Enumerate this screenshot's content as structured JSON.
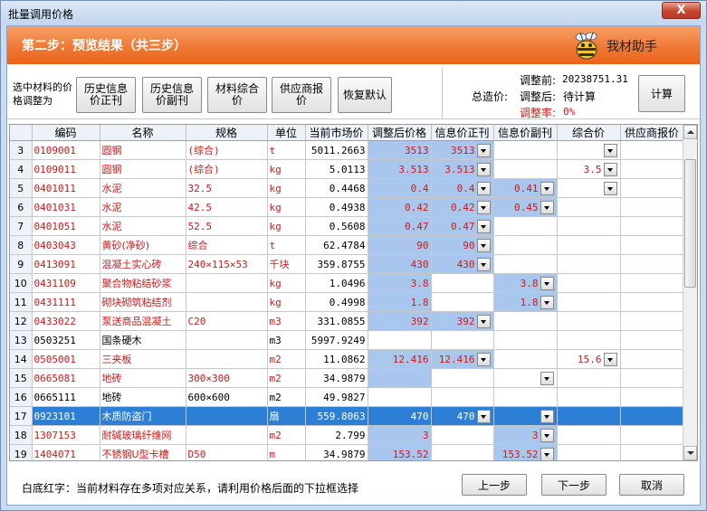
{
  "window": {
    "title": "批量调用价格",
    "close_label": "X"
  },
  "banner": {
    "step_title": "第二步：预览结果（共三步）",
    "helper_label": "我材助手"
  },
  "toolbar": {
    "adjust_label": "选中材料的价格调整为",
    "buttons": [
      "历史信息价正刊",
      "历史信息价副刊",
      "材料综合价",
      "供应商报价",
      "恢复默认"
    ],
    "calc_label": "计算"
  },
  "summary": {
    "before_label": "调整前:",
    "before_value": "20238751.31",
    "total_label": "总造价:",
    "after_label": "调整后:",
    "after_value": "待计算",
    "rate_label": "调整率:",
    "rate_value": "0%"
  },
  "grid": {
    "columns": [
      "",
      "编码",
      "名称",
      "规格",
      "单位",
      "当前市场价",
      "调整后价格",
      "信息价正刊",
      "信息价副刊",
      "综合价",
      "供应商报价"
    ],
    "rows": [
      {
        "n": "3",
        "code": "0109001",
        "name": "圆钢",
        "spec": "(综合)",
        "unit": "t",
        "market": "5011.2663",
        "adj": "3513",
        "main": "3513",
        "main_dd": true,
        "sub": "",
        "sub_dd": false,
        "comp": "",
        "comp_dd": true,
        "red": true,
        "sel": false
      },
      {
        "n": "4",
        "code": "0109011",
        "name": "圆钢",
        "spec": "(综合)",
        "unit": "kg",
        "market": "5.0113",
        "adj": "3.513",
        "main": "3.513",
        "main_dd": true,
        "sub": "",
        "sub_dd": false,
        "comp": "3.5",
        "comp_dd": true,
        "red": true,
        "sel": false
      },
      {
        "n": "5",
        "code": "0401011",
        "name": "水泥",
        "spec": "32.5",
        "unit": "kg",
        "market": "0.4468",
        "adj": "0.4",
        "main": "0.4",
        "main_dd": true,
        "sub": "0.41",
        "sub_dd": true,
        "comp": "",
        "comp_dd": true,
        "red": true,
        "sel": false
      },
      {
        "n": "6",
        "code": "0401031",
        "name": "水泥",
        "spec": "42.5",
        "unit": "kg",
        "market": "0.4938",
        "adj": "0.42",
        "main": "0.42",
        "main_dd": true,
        "sub": "0.45",
        "sub_dd": true,
        "comp": "",
        "comp_dd": false,
        "red": true,
        "sel": false
      },
      {
        "n": "7",
        "code": "0401051",
        "name": "水泥",
        "spec": "52.5",
        "unit": "kg",
        "market": "0.5608",
        "adj": "0.47",
        "main": "0.47",
        "main_dd": true,
        "sub": "",
        "sub_dd": false,
        "comp": "",
        "comp_dd": false,
        "red": true,
        "sel": false
      },
      {
        "n": "8",
        "code": "0403043",
        "name": "黄砂(净砂)",
        "spec": "综合",
        "unit": "t",
        "market": "62.4784",
        "adj": "90",
        "main": "90",
        "main_dd": true,
        "sub": "",
        "sub_dd": false,
        "comp": "",
        "comp_dd": false,
        "red": true,
        "sel": false
      },
      {
        "n": "9",
        "code": "0413091",
        "name": "混凝土实心砖",
        "spec": "240×115×53",
        "unit": "千块",
        "market": "359.8755",
        "adj": "430",
        "main": "430",
        "main_dd": true,
        "sub": "",
        "sub_dd": false,
        "comp": "",
        "comp_dd": false,
        "red": true,
        "sel": false
      },
      {
        "n": "10",
        "code": "0431109",
        "name": "聚合物粘结砂浆",
        "spec": "",
        "unit": "kg",
        "market": "1.0496",
        "adj": "3.8",
        "main": "",
        "main_dd": false,
        "sub": "3.8",
        "sub_dd": true,
        "comp": "",
        "comp_dd": false,
        "red": true,
        "sel": false
      },
      {
        "n": "11",
        "code": "0431111",
        "name": "砌块砌筑粘结剂",
        "spec": "",
        "unit": "kg",
        "market": "0.4998",
        "adj": "1.8",
        "main": "",
        "main_dd": false,
        "sub": "1.8",
        "sub_dd": true,
        "comp": "",
        "comp_dd": false,
        "red": true,
        "sel": false
      },
      {
        "n": "12",
        "code": "0433022",
        "name": "泵送商品混凝土",
        "spec": "C20",
        "unit": "m3",
        "market": "331.0855",
        "adj": "392",
        "main": "392",
        "main_dd": true,
        "sub": "",
        "sub_dd": false,
        "comp": "",
        "comp_dd": false,
        "red": true,
        "sel": false
      },
      {
        "n": "13",
        "code": "0503251",
        "name": "国条硬木",
        "spec": "",
        "unit": "m3",
        "market": "5997.9249",
        "adj": "",
        "main": "",
        "main_dd": false,
        "sub": "",
        "sub_dd": false,
        "comp": "",
        "comp_dd": false,
        "red": false,
        "sel": false
      },
      {
        "n": "14",
        "code": "0505001",
        "name": "三夹板",
        "spec": "",
        "unit": "m2",
        "market": "11.0862",
        "adj": "12.416",
        "main": "12.416",
        "main_dd": true,
        "sub": "",
        "sub_dd": false,
        "comp": "15.6",
        "comp_dd": true,
        "red": true,
        "sel": false
      },
      {
        "n": "15",
        "code": "0665081",
        "name": "地砖",
        "spec": "300×300",
        "unit": "m2",
        "market": "34.9879",
        "adj": "",
        "main": "",
        "main_dd": false,
        "sub": "",
        "sub_dd": true,
        "comp": "",
        "comp_dd": false,
        "red": true,
        "sel": false
      },
      {
        "n": "16",
        "code": "0665111",
        "name": "地砖",
        "spec": "600×600",
        "unit": "m2",
        "market": "49.9827",
        "adj": "",
        "main": "",
        "main_dd": false,
        "sub": "",
        "sub_dd": false,
        "comp": "",
        "comp_dd": false,
        "red": false,
        "sel": false
      },
      {
        "n": "17",
        "code": "0923101",
        "name": "木质防盗门",
        "spec": "",
        "unit": "扇",
        "market": "559.8063",
        "adj": "470",
        "main": "470",
        "main_dd": true,
        "sub": "",
        "sub_dd": true,
        "comp": "",
        "comp_dd": false,
        "red": false,
        "sel": true
      },
      {
        "n": "18",
        "code": "1307153",
        "name": "耐碱玻璃纤维网",
        "spec": "",
        "unit": "m2",
        "market": "2.799",
        "adj": "3",
        "main": "",
        "main_dd": false,
        "sub": "3",
        "sub_dd": true,
        "comp": "",
        "comp_dd": false,
        "red": true,
        "sel": false
      },
      {
        "n": "19",
        "code": "1404071",
        "name": "不锈钢U型卡槽",
        "spec": "D50",
        "unit": "m",
        "market": "34.9879",
        "adj": "153.52",
        "main": "",
        "main_dd": false,
        "sub": "153.52",
        "sub_dd": true,
        "comp": "",
        "comp_dd": false,
        "red": true,
        "sel": false
      }
    ]
  },
  "footer": {
    "note": "白底红字：当前材料存在多项对应关系，请利用价格后面的下拉框选择",
    "prev_label": "上一步",
    "next_label": "下一步",
    "cancel_label": "取消"
  },
  "colors": {
    "banner": "#ee7632",
    "highlight": "#a9c7ec",
    "selected": "#2d7fd6",
    "red_text": "#d01818"
  }
}
